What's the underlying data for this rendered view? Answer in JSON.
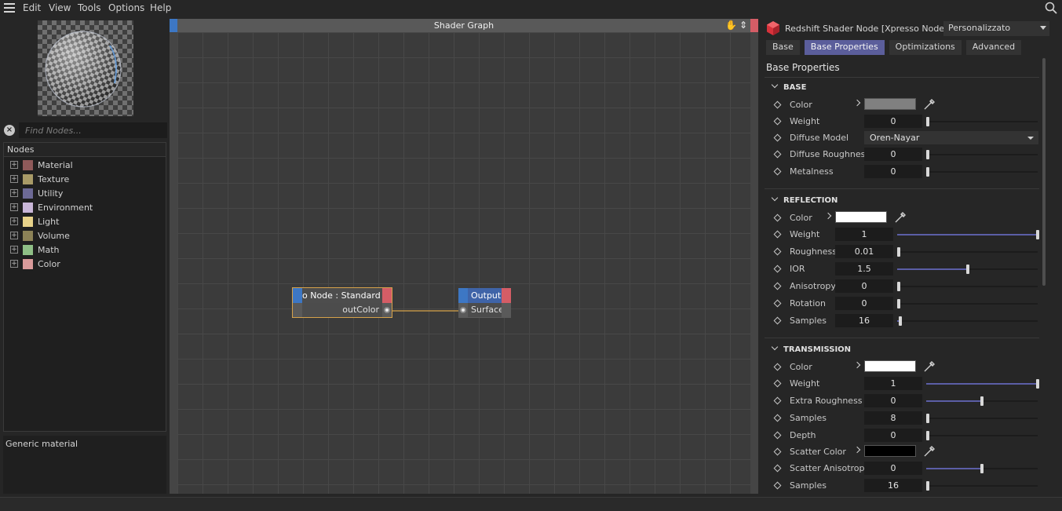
{
  "menu": {
    "items": [
      "Edit",
      "View",
      "Tools",
      "Options",
      "Help"
    ]
  },
  "left": {
    "search_placeholder": "Find Nodes...",
    "nodes_header": "Nodes",
    "categories": [
      {
        "label": "Material",
        "color": "#8f5a5a"
      },
      {
        "label": "Texture",
        "color": "#a89a67"
      },
      {
        "label": "Utility",
        "color": "#6d6a96"
      },
      {
        "label": "Environment",
        "color": "#c9b6d8"
      },
      {
        "label": "Light",
        "color": "#e8d28a"
      },
      {
        "label": "Volume",
        "color": "#8c8257"
      },
      {
        "label": "Math",
        "color": "#8fbf86"
      },
      {
        "label": "Color",
        "color": "#d99a9a"
      }
    ],
    "description": "Generic material"
  },
  "graph": {
    "title": "Shader Graph",
    "node_material": {
      "title": "o Node : Standard M",
      "port_out": "outColor"
    },
    "node_output": {
      "title": "Output",
      "port_in": "Surface"
    }
  },
  "attributes": {
    "node_name": "Redshift Shader Node [Xpresso Node]",
    "preset": "Personalizzato",
    "tabs": [
      "Base",
      "Base Properties",
      "Optimizations",
      "Advanced"
    ],
    "active_tab": "Base Properties",
    "section_title": "Base Properties",
    "base": {
      "title": "BASE",
      "color_label": "Color",
      "color_value": "#808080",
      "weight": {
        "label": "Weight",
        "value": "0",
        "fraction": 0.0
      },
      "diffuse_model": {
        "label": "Diffuse Model",
        "value": "Oren-Nayar"
      },
      "diffuse_roughness": {
        "label": "Diffuse Roughness",
        "value": "0",
        "fraction": 0.0
      },
      "metalness": {
        "label": "Metalness",
        "value": "0",
        "fraction": 0.0
      }
    },
    "reflection": {
      "title": "REFLECTION",
      "color_label": "Color",
      "color_value": "#ffffff",
      "weight": {
        "label": "Weight",
        "value": "1",
        "fraction": 1.0
      },
      "roughness": {
        "label": "Roughness",
        "value": "0.01",
        "fraction": 0.01
      },
      "ior": {
        "label": "IOR",
        "value": "1.5",
        "fraction": 0.5
      },
      "anisotropy": {
        "label": "Anisotropy",
        "value": "0",
        "fraction": 0.0
      },
      "rotation": {
        "label": "Rotation",
        "value": "0",
        "fraction": 0.0
      },
      "samples": {
        "label": "Samples",
        "value": "16",
        "fraction": 0.02
      }
    },
    "transmission": {
      "title": "TRANSMISSION",
      "color_label": "Color",
      "color_value": "#ffffff",
      "weight": {
        "label": "Weight",
        "value": "1",
        "fraction": 1.0
      },
      "extra_roughness": {
        "label": "Extra Roughness",
        "value": "0",
        "fraction": 0.5
      },
      "samples": {
        "label": "Samples",
        "value": "8",
        "fraction": 0.0
      },
      "depth": {
        "label": "Depth",
        "value": "0",
        "fraction": 0.0
      },
      "scatter_color_label": "Scatter Color",
      "scatter_color_value": "#000000",
      "scatter_anisotropy": {
        "label": "Scatter Anisotropy",
        "value": "0",
        "fraction": 0.5
      },
      "samples2": {
        "label": "Samples",
        "value": "16",
        "fraction": 0.0
      }
    }
  },
  "colors": {
    "accent": "#5b5e9b",
    "node_blue": "#3d77c4",
    "node_red": "#d45d66",
    "wire": "#d6a24a"
  }
}
